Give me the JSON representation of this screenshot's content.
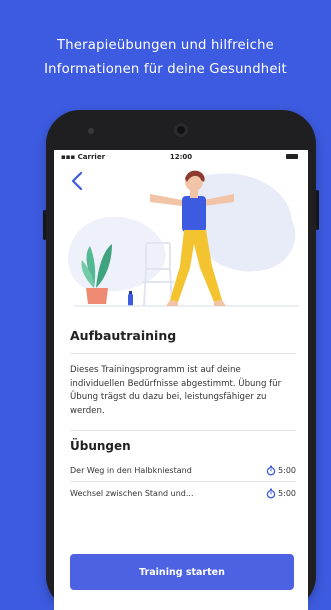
{
  "headline": {
    "line1": "Therapieübungen und hilfreiche",
    "line2": "Informationen für deine Gesundheit"
  },
  "statusbar": {
    "carrier": "Carrier",
    "time": "12:00"
  },
  "detail": {
    "title": "Aufbautraining",
    "description": "Dieses Trainingsprogramm ist auf deine individuellen Bedürfnisse abgestimmt. Übung für Übung trägst du dazu bei, leistungsfähiger zu werden.",
    "section_title": "Übungen",
    "exercises": [
      {
        "name": "Der Weg in den Halbkniestand",
        "duration": "5:00"
      },
      {
        "name": "Wechsel zwischen Stand und...",
        "duration": "5:00"
      }
    ],
    "cta_label": "Training starten"
  },
  "colors": {
    "background": "#3d5be0",
    "accent": "#4c62e3",
    "shirt": "#3d5be0",
    "pants": "#f4c430"
  },
  "icons": {
    "back": "chevron-left-icon",
    "duration": "stopwatch-icon"
  }
}
